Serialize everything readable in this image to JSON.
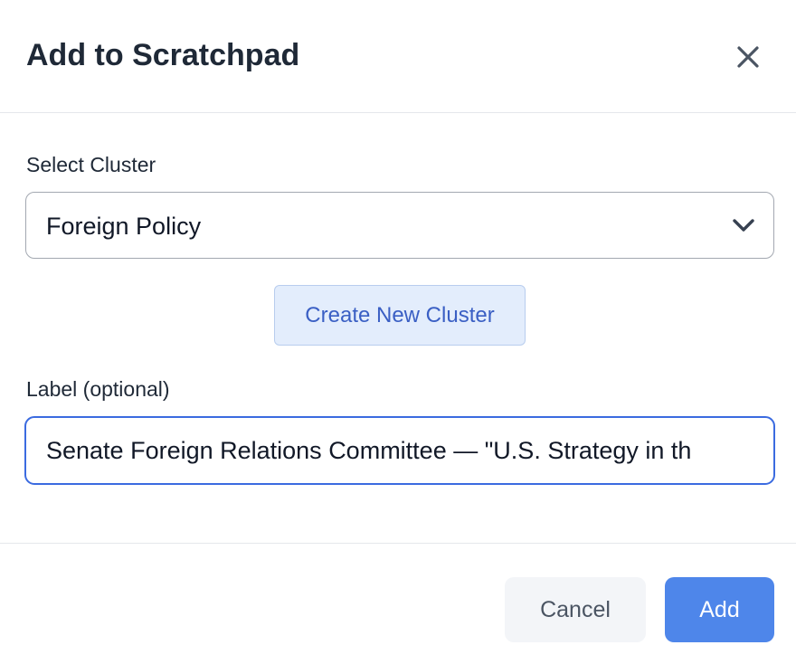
{
  "dialog": {
    "title": "Add to Scratchpad",
    "close_icon": "close-icon"
  },
  "cluster": {
    "label": "Select Cluster",
    "selected": "Foreign Policy",
    "chevron_icon": "chevron-down-icon",
    "create_button": "Create New Cluster"
  },
  "label_field": {
    "label": "Label (optional)",
    "value": "Senate Foreign Relations Committee — \"U.S. Strategy in th"
  },
  "footer": {
    "cancel": "Cancel",
    "add": "Add"
  },
  "colors": {
    "primary": "#4e86ea",
    "focus_border": "#3b6be0",
    "secondary_bg": "#e3edfc"
  }
}
